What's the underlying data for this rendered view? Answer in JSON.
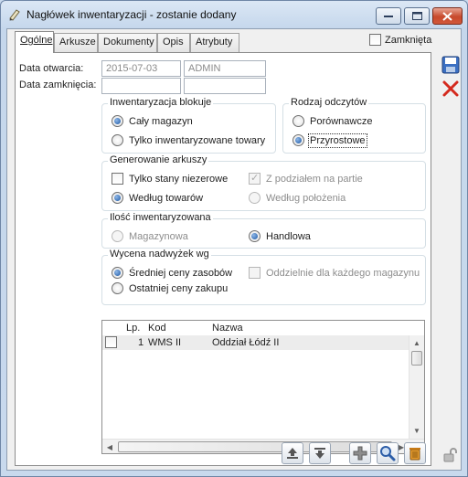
{
  "window": {
    "title": "Nagłówek inwentaryzacji - zostanie dodany",
    "controls": [
      "minimize-icon",
      "maximize-icon",
      "close-icon"
    ]
  },
  "tabs": [
    {
      "label": "Ogólne",
      "active": true
    },
    {
      "label": "Arkusze",
      "active": false
    },
    {
      "label": "Dokumenty",
      "active": false
    },
    {
      "label": "Opis",
      "active": false
    },
    {
      "label": "Atrybuty",
      "active": false
    }
  ],
  "closed": {
    "label": "Zamknięta",
    "checked": false
  },
  "dates": {
    "open_label": "Data otwarcia:",
    "open_value": "2015-07-03",
    "open_user": "ADMIN",
    "close_label": "Data zamknięcia:",
    "close_value": "",
    "close_user": ""
  },
  "blocks": {
    "title": "Inwentaryzacja blokuje",
    "options": [
      {
        "label": "Cały magazyn",
        "selected": true
      },
      {
        "label": "Tylko inwentaryzowane towary",
        "selected": false
      }
    ]
  },
  "reading": {
    "title": "Rodzaj odczytów",
    "options": [
      {
        "label": "Porównawcze",
        "selected": false
      },
      {
        "label": "Przyrostowe",
        "selected": true
      }
    ]
  },
  "generate": {
    "title": "Generowanie arkuszy",
    "only_nonzero": "Tylko stany niezerowe",
    "by_batch": "Z podziałem na partie",
    "by_goods": "Według towarów",
    "by_location": "Według położenia"
  },
  "quantity": {
    "title": "Ilość inwentaryzowana",
    "warehouse": "Magazynowa",
    "commercial": "Handlowa"
  },
  "valuation": {
    "title": "Wycena nadwyżek wg",
    "average": "Średniej ceny zasobów",
    "separately": "Oddzielnie dla każdego magazynu",
    "last": "Ostatniej ceny zakupu"
  },
  "table": {
    "columns": [
      "Lp.",
      "Kod",
      "Nazwa"
    ],
    "rows": [
      {
        "lp": "1",
        "kod": "WMS II",
        "nazwa": "Oddział Łódź II"
      }
    ]
  },
  "side_icons": [
    "save-icon",
    "cancel-icon"
  ],
  "bottom_icons": [
    "export-icon",
    "import-icon",
    "add-icon",
    "zoom-icon",
    "delete-icon",
    "lock-icon"
  ],
  "colors": {
    "titlebar": "#dbe7f5",
    "close_button": "#c7492c",
    "selection": "#ececec"
  }
}
